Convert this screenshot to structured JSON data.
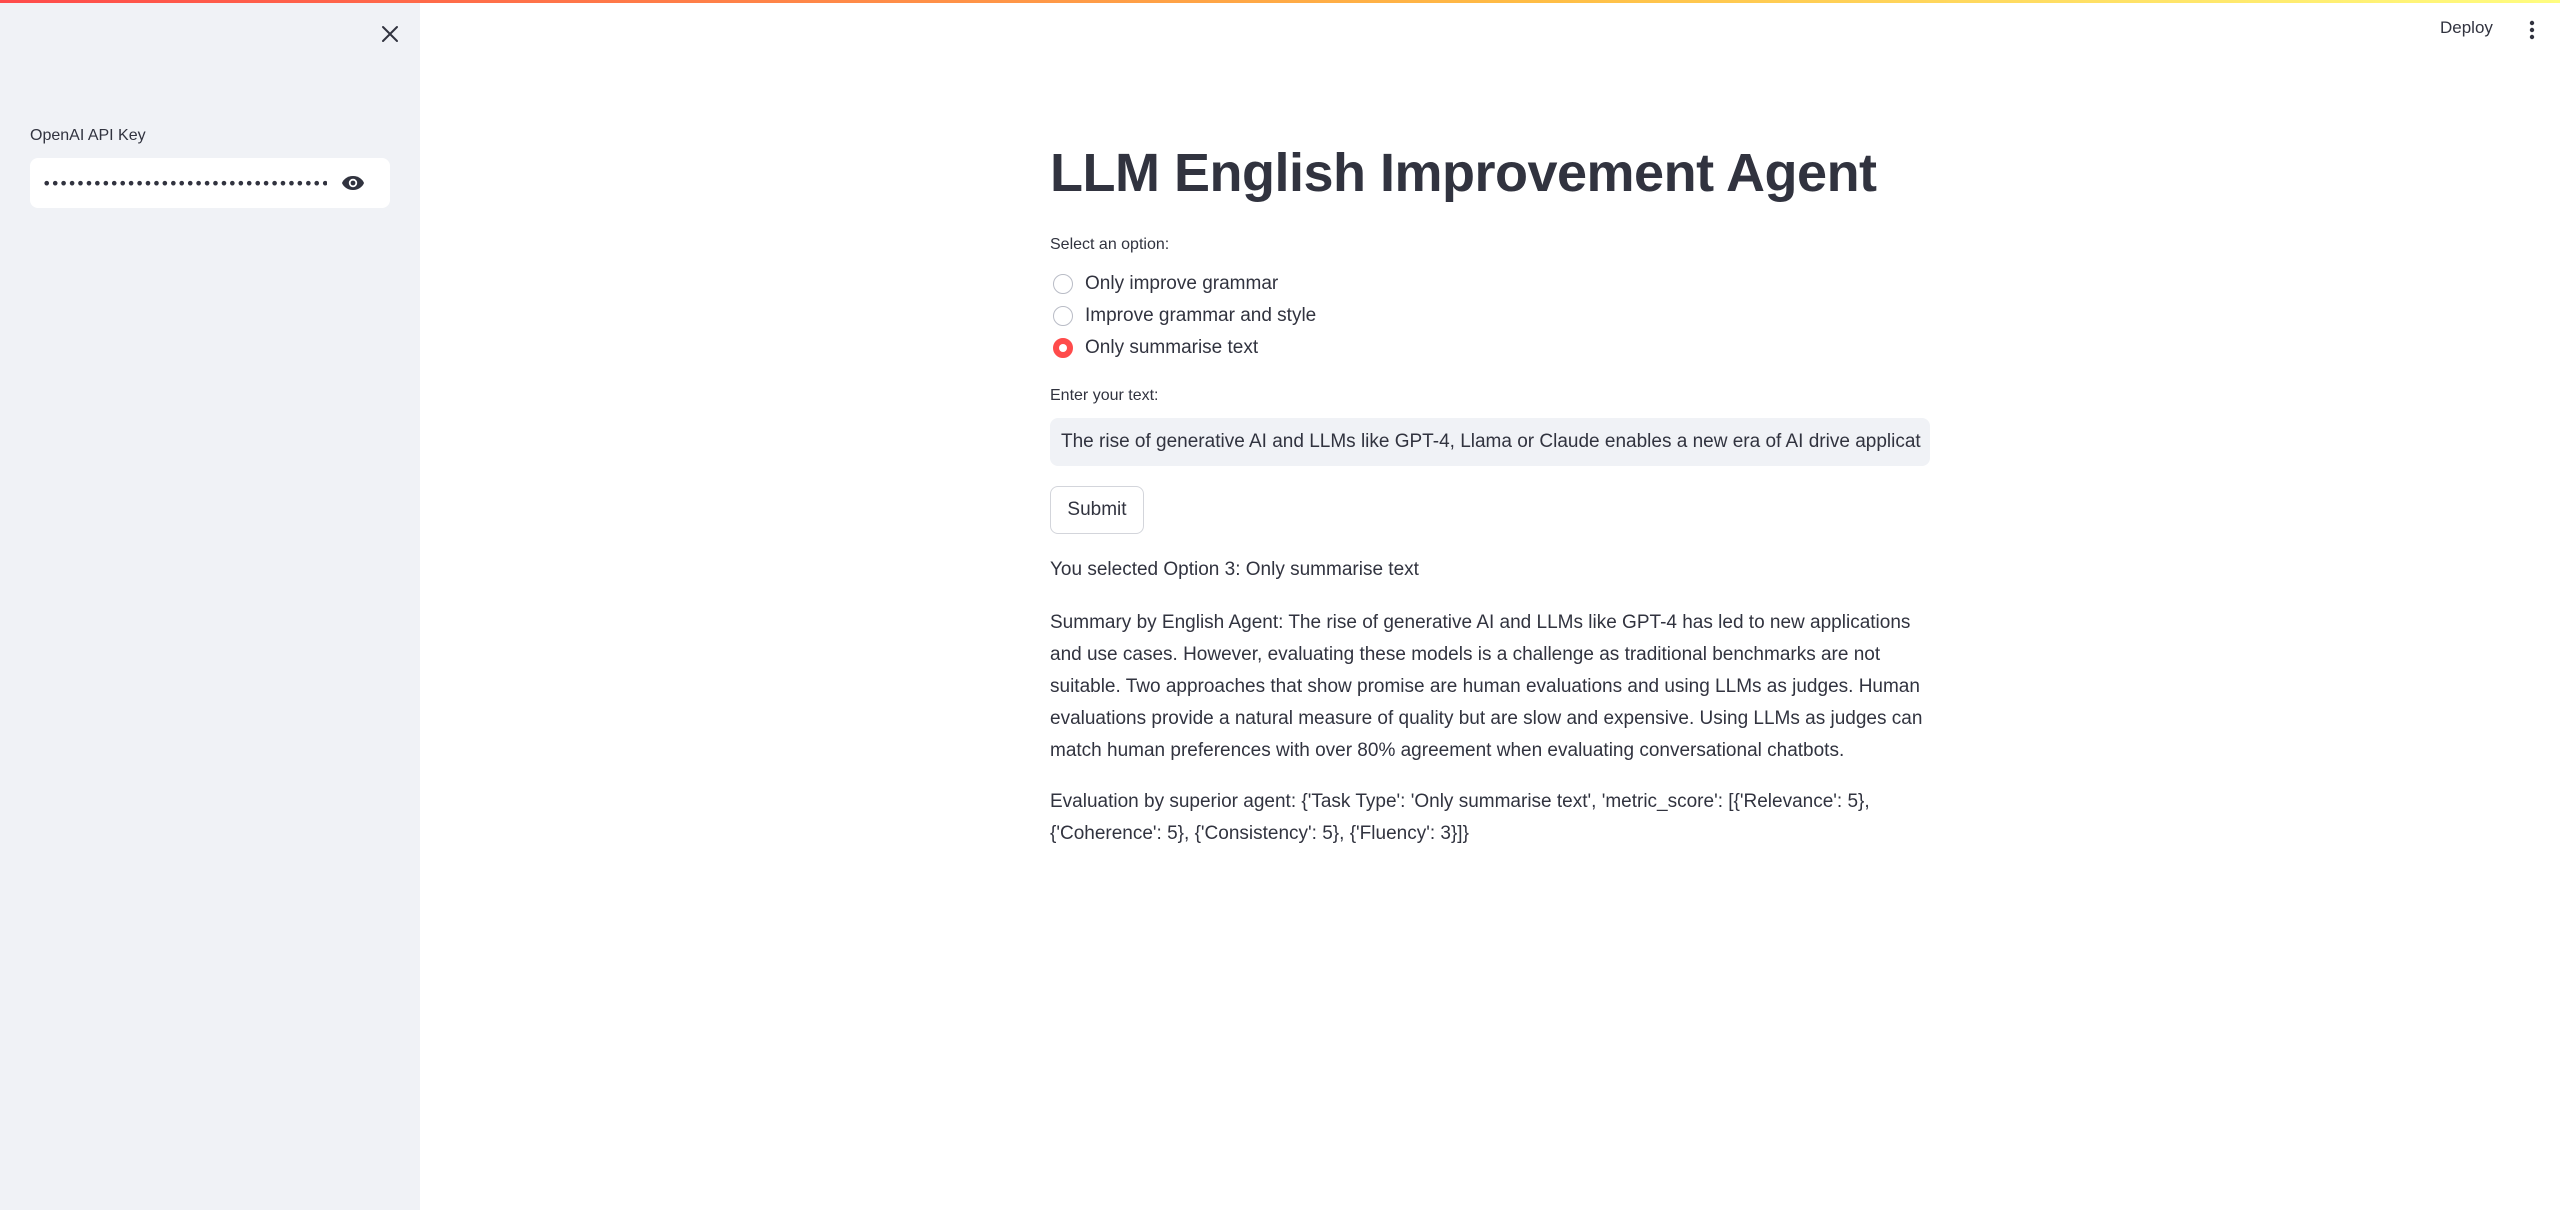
{
  "sidebar": {
    "api_key_label": "OpenAI API Key",
    "api_key_value": "••••••••••••••••••••••••••••••••••••••••••••••••••••••••"
  },
  "header": {
    "deploy_label": "Deploy"
  },
  "main": {
    "title": "LLM English Improvement Agent",
    "radio_group_label": "Select an option:",
    "options": [
      {
        "label": "Only improve grammar",
        "selected": false
      },
      {
        "label": "Improve grammar and style",
        "selected": false
      },
      {
        "label": "Only summarise text",
        "selected": true
      }
    ],
    "text_input_label": "Enter your text:",
    "text_input_value": "The rise of generative AI and LLMs like GPT-4, Llama or Claude enables a new era of AI drive applications",
    "submit_label": "Submit",
    "selected_message": "You selected Option 3: Only summarise text",
    "summary": "Summary by English Agent: The rise of generative AI and LLMs like GPT-4 has led to new applications and use cases. However, evaluating these models is a challenge as traditional benchmarks are not suitable. Two approaches that show promise are human evaluations and using LLMs as judges. Human evaluations provide a natural measure of quality but are slow and expensive. Using LLMs as judges can match human preferences with over 80% agreement when evaluating conversational chatbots.",
    "evaluation": "Evaluation by superior agent: {'Task Type': 'Only summarise text', 'metric_score': [{'Relevance': 5}, {'Coherence': 5}, {'Consistency': 5}, {'Fluency': 3}]}"
  },
  "colors": {
    "accent": "#ff4b4b",
    "sidebar_bg": "#f0f2f6",
    "text": "#31333f"
  },
  "icons": {
    "sidebar_close": "close-icon",
    "password_toggle": "eye-icon",
    "main_menu": "kebab-menu-icon"
  }
}
